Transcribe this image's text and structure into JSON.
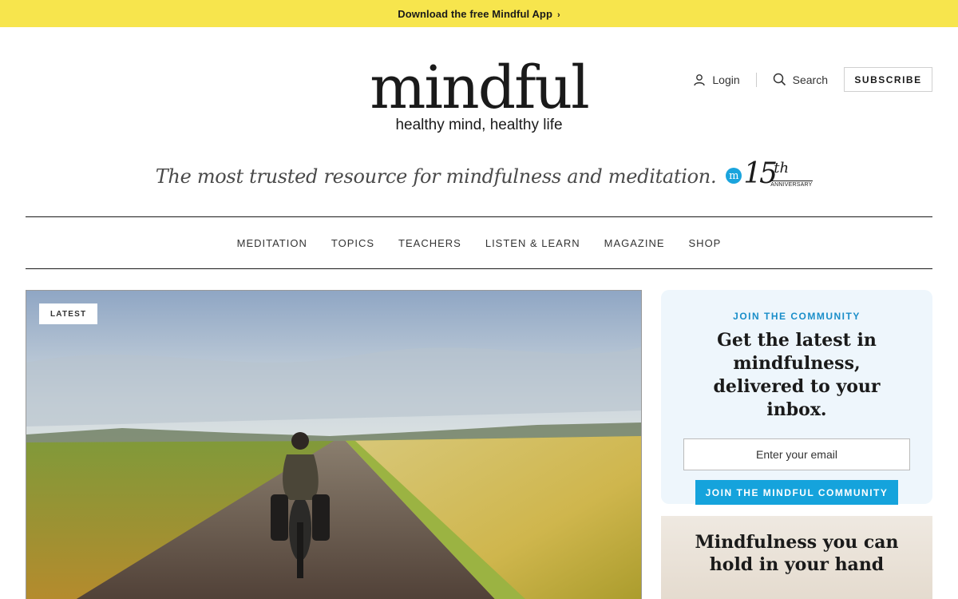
{
  "top_banner": {
    "text": "Download the free Mindful App",
    "chevron": "›"
  },
  "brand": {
    "wordmark": "mindful",
    "tagline": "healthy mind, healthy life"
  },
  "header_tools": {
    "login_label": "Login",
    "search_label": "Search",
    "subscribe_label": "SUBSCRIBE"
  },
  "mission": {
    "text": "The most trusted resource for mindfulness and meditation.",
    "anniversary_number": "15",
    "anniversary_suffix": "th",
    "anniversary_word": "ANNIVERSARY",
    "badge_letter": "m"
  },
  "nav": {
    "items": [
      {
        "label": "MEDITATION"
      },
      {
        "label": "TOPICS"
      },
      {
        "label": "TEACHERS"
      },
      {
        "label": "LISTEN & LEARN"
      },
      {
        "label": "MAGAZINE"
      },
      {
        "label": "SHOP"
      }
    ]
  },
  "hero": {
    "badge": "LATEST"
  },
  "signup": {
    "eyebrow": "JOIN THE COMMUNITY",
    "heading": "Get the latest in mindfulness, delivered to your inbox.",
    "email_placeholder": "Enter your email",
    "button_label": "JOIN THE MINDFUL COMMUNITY"
  },
  "promo": {
    "heading": "Mindfulness you can hold in your hand"
  },
  "colors": {
    "banner": "#f7e54d",
    "accent_blue": "#15a3dc",
    "signup_bg": "#eef6fc"
  },
  "icons": {
    "login": "user-icon",
    "search": "search-icon"
  }
}
